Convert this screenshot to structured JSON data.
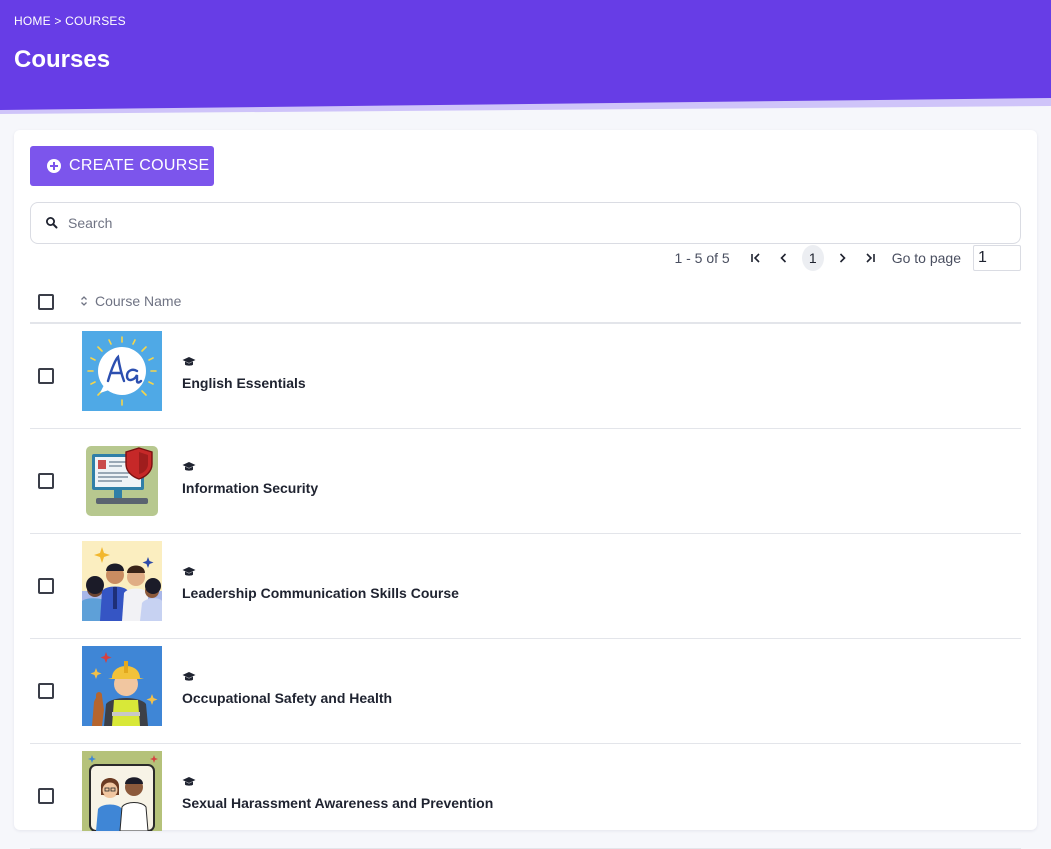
{
  "header": {
    "breadcrumb": "HOME > COURSES",
    "title": "Courses",
    "bg_color": "#673de6"
  },
  "toolbar": {
    "create_label": "CREATE COURSE",
    "accent_color": "#7c55ec"
  },
  "search": {
    "placeholder": "Search",
    "value": ""
  },
  "pagination": {
    "range_text": "1 - 5 of 5",
    "current_page": "1",
    "goto_label": "Go to page",
    "goto_value": "1"
  },
  "table": {
    "column_header": "Course Name",
    "rows": [
      {
        "name": "English Essentials",
        "thumb_icon": "alphabet-speech-bubble-icon"
      },
      {
        "name": "Information Security",
        "thumb_icon": "monitor-shield-icon"
      },
      {
        "name": "Leadership Communication Skills Course",
        "thumb_icon": "team-people-icon"
      },
      {
        "name": "Occupational Safety and Health",
        "thumb_icon": "hardhat-worker-icon"
      },
      {
        "name": "Sexual Harassment Awareness and Prevention",
        "thumb_icon": "two-people-frame-icon"
      }
    ]
  }
}
